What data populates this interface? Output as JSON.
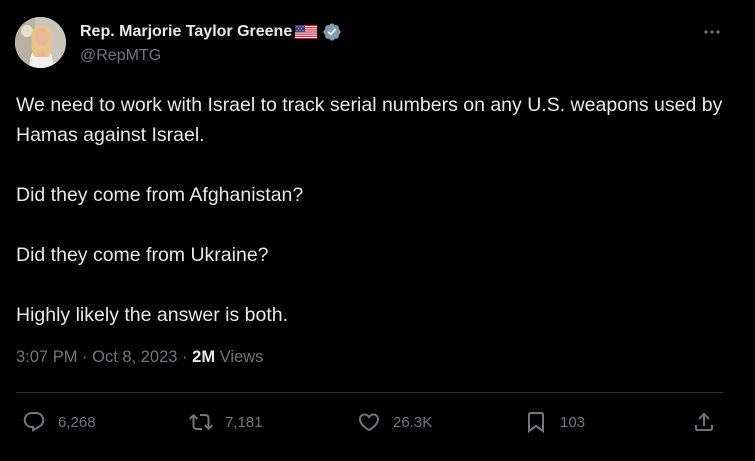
{
  "author": {
    "display_name": "Rep. Marjorie Taylor Greene",
    "handle": "@RepMTG",
    "avatar_icon": "profile-photo",
    "flag_icon": "us-flag-icon",
    "verified_icon": "verified-badge-icon",
    "verified_color": "#829aab"
  },
  "tweet": {
    "paragraphs": [
      "We need to work with Israel to track serial numbers on any U.S. weapons used by Hamas against Israel.",
      "Did they come from Afghanistan?",
      "Did they come from Ukraine?",
      "Highly likely the answer is both."
    ],
    "time": "3:07 PM",
    "separator": "·",
    "date": "Oct 8, 2023",
    "views_count": "2M",
    "views_label": "Views"
  },
  "actions": {
    "replies": "6,268",
    "reposts": "7,181",
    "likes": "26.3K",
    "bookmarks": "103"
  },
  "colors": {
    "background": "#000000",
    "text": "#e7e9ea",
    "secondary": "#71767b",
    "divider": "#2f3336"
  }
}
